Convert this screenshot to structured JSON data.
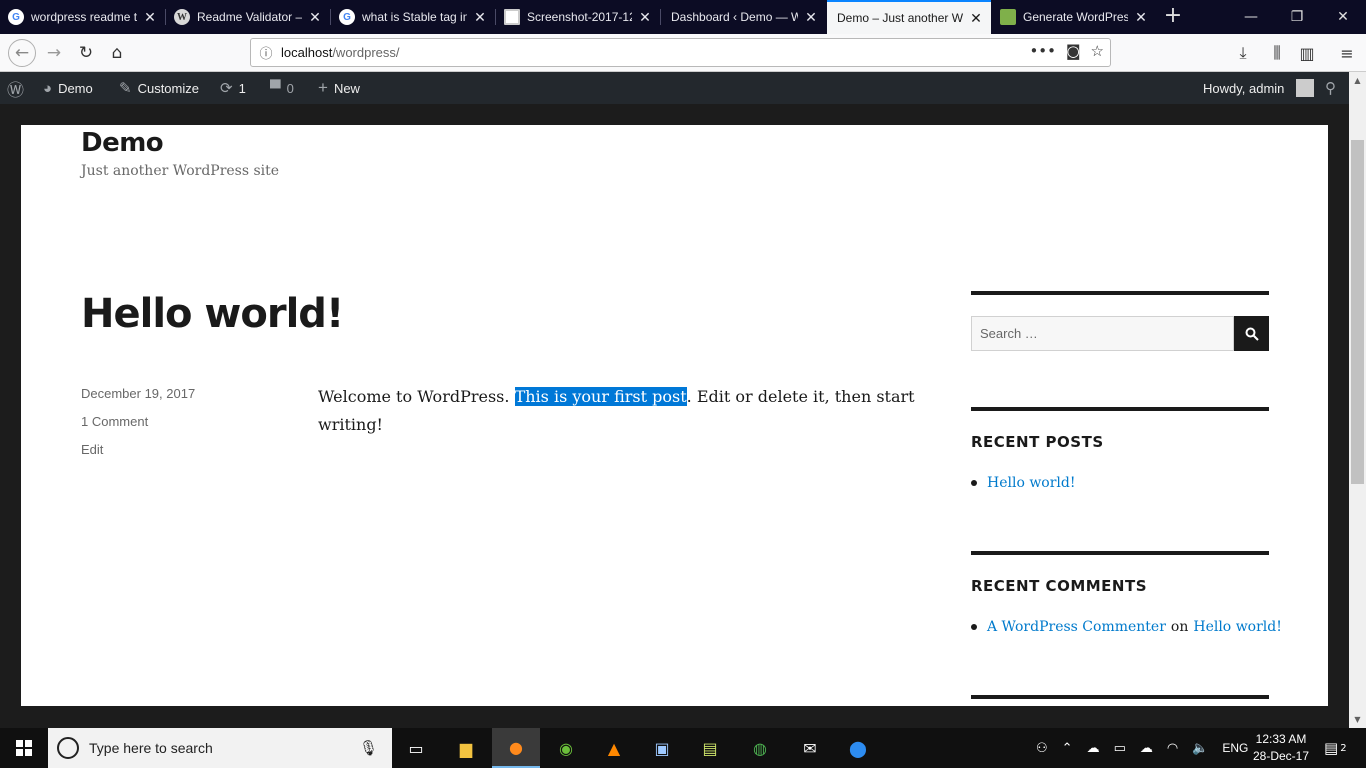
{
  "browser": {
    "tabs": [
      {
        "title": "wordpress readme t",
        "favicon": "google-icon",
        "active": false
      },
      {
        "title": "Readme Validator —",
        "favicon": "wordpress-icon",
        "active": false
      },
      {
        "title": "what is Stable tag in",
        "favicon": "google-icon",
        "active": false
      },
      {
        "title": "Screenshot-2017-12",
        "favicon": "image-icon",
        "active": false
      },
      {
        "title": "Dashboard ‹ Demo — W",
        "favicon": "none",
        "active": false
      },
      {
        "title": "Demo – Just another Wo",
        "favicon": "none",
        "active": true
      },
      {
        "title": "Generate WordPress",
        "favicon": "generator-icon",
        "active": false
      }
    ],
    "url_host": "localhost",
    "url_path": "/wordpress/"
  },
  "adminbar": {
    "site_name": "Demo",
    "customize": "Customize",
    "updates_count": "1",
    "comments_count": "0",
    "new_label": "New",
    "howdy": "Howdy, admin"
  },
  "site": {
    "title": "Demo",
    "description": "Just another WordPress site"
  },
  "post": {
    "title": "Hello world!",
    "date": "December 19, 2017",
    "comments": "1 Comment",
    "edit": "Edit",
    "content_before": "Welcome to WordPress. ",
    "content_selected": "This is your first post",
    "content_after": ". Edit or delete it, then start writing!"
  },
  "sidebar": {
    "search_placeholder": "Search …",
    "recent_posts_title": "RECENT POSTS",
    "recent_posts": [
      "Hello world!"
    ],
    "recent_comments_title": "RECENT COMMENTS",
    "comment_author": "A WordPress Commenter",
    "comment_on": "on",
    "comment_post": "Hello world!"
  },
  "taskbar": {
    "search_placeholder": "Type here to search",
    "language": "ENG",
    "time": "12:33 AM",
    "date": "28-Dec-17",
    "notifications": "2"
  },
  "colors": {
    "accent": "#007acc",
    "selection": "#0078d7",
    "adminbar": "#23282d"
  }
}
